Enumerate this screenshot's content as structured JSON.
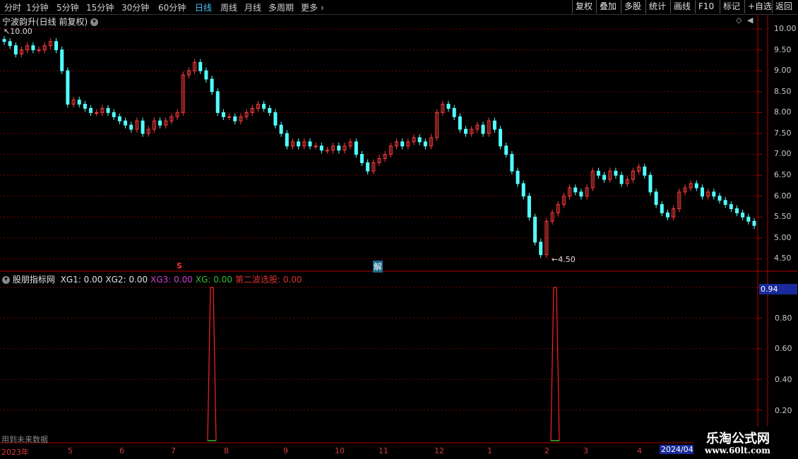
{
  "toolbar": {
    "timeframes": [
      "分时",
      "1分钟",
      "5分钟",
      "15分钟",
      "30分钟",
      "60分钟",
      "日线",
      "周线",
      "月线",
      "多周期"
    ],
    "active_timeframe": "日线",
    "more_label": "更多",
    "right_buttons": [
      "复权",
      "叠加",
      "多股",
      "统计",
      "画线",
      "F10",
      "标记",
      "+自选",
      "返回"
    ]
  },
  "main_panel": {
    "title": "宁波韵升(日线 前复权)",
    "y_labels": [
      "10.00",
      "9.50",
      "9.00",
      "8.50",
      "8.00",
      "7.50",
      "7.00",
      "6.50",
      "6.00",
      "5.50",
      "5.00",
      "4.50"
    ],
    "high_marker": "10.00",
    "low_marker": "4.50",
    "marker_s": "S",
    "marker_jie": "解"
  },
  "indicator_panel": {
    "name": "股朋指标网",
    "fields": [
      {
        "label": "XG1:",
        "value": "0.00",
        "color": "#e0e0e0"
      },
      {
        "label": "XG2:",
        "value": "0.00",
        "color": "#e0e0e0"
      },
      {
        "label": "XG3:",
        "value": "0.00",
        "color": "#d040d0"
      },
      {
        "label": "XG:",
        "value": "0.00",
        "color": "#30c030"
      },
      {
        "label": "第二波选股:",
        "value": "0.00",
        "color": "#e03030"
      }
    ],
    "y_labels": [
      "0.80",
      "0.60",
      "0.40",
      "0.20"
    ],
    "current_value": "0.94",
    "footer_note": "用到未来数据"
  },
  "x_axis": {
    "labels": [
      "2023年",
      "5",
      "6",
      "7",
      "8",
      "9",
      "10",
      "11",
      "12",
      "1",
      "2",
      "3",
      "4"
    ],
    "current_date": "2024/04"
  },
  "watermark": {
    "line1": "乐淘公式网",
    "line2": "www.60lt.com"
  },
  "colors": {
    "up": "#ff3c3c",
    "down": "#54ffff",
    "grid": "#7a0000",
    "spike": "#ff2020"
  },
  "chart_data": {
    "type": "candlestick",
    "title": "宁波韵升(日线 前复权)",
    "ylim": [
      4.3,
      10.2
    ],
    "high": 10.0,
    "low": 4.5,
    "close_path": [
      9.7,
      9.6,
      9.4,
      9.5,
      9.6,
      9.5,
      9.5,
      9.6,
      9.7,
      9.5,
      9.0,
      8.2,
      8.3,
      8.2,
      8.1,
      8.0,
      8.0,
      8.1,
      8.0,
      7.9,
      7.8,
      7.7,
      7.6,
      7.8,
      7.5,
      7.6,
      7.8,
      7.7,
      7.8,
      7.9,
      8.0,
      8.9,
      9.0,
      9.2,
      9.0,
      8.8,
      8.5,
      8.0,
      7.9,
      7.9,
      7.8,
      7.9,
      8.0,
      8.1,
      8.2,
      8.1,
      8.0,
      7.7,
      7.5,
      7.2,
      7.3,
      7.2,
      7.3,
      7.2,
      7.2,
      7.1,
      7.1,
      7.2,
      7.1,
      7.2,
      7.3,
      7.0,
      6.8,
      6.6,
      6.8,
      6.9,
      7.0,
      7.2,
      7.3,
      7.2,
      7.3,
      7.4,
      7.3,
      7.2,
      7.4,
      8.0,
      8.2,
      8.1,
      7.9,
      7.6,
      7.5,
      7.6,
      7.7,
      7.5,
      7.8,
      7.6,
      7.2,
      7.0,
      6.6,
      6.3,
      6.0,
      5.5,
      4.9,
      4.6,
      5.4,
      5.6,
      5.8,
      6.0,
      6.2,
      6.1,
      6.0,
      6.2,
      6.6,
      6.5,
      6.4,
      6.6,
      6.5,
      6.3,
      6.4,
      6.6,
      6.7,
      6.5,
      6.1,
      5.8,
      5.6,
      5.5,
      5.7,
      6.1,
      6.2,
      6.3,
      6.2,
      6.0,
      6.1,
      6.0,
      5.9,
      5.8,
      5.7,
      5.6,
      5.5,
      5.4,
      5.3
    ],
    "indicator_spikes": [
      {
        "after_x_label": "7",
        "value": 1.0
      },
      {
        "after_x_label": "2",
        "value": 1.0
      }
    ]
  }
}
